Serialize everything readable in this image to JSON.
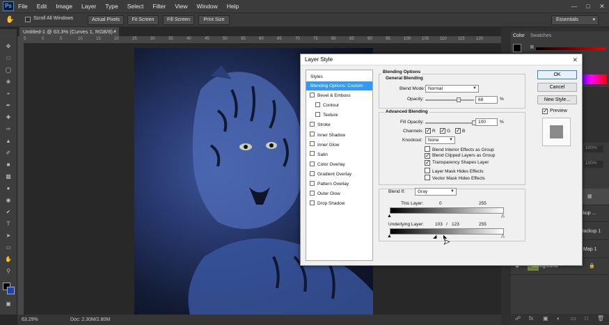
{
  "app": {
    "logo": "Ps"
  },
  "menu": [
    "File",
    "Edit",
    "Image",
    "Layer",
    "Type",
    "Select",
    "Filter",
    "View",
    "Window",
    "Help"
  ],
  "options_bar": {
    "scroll_all_windows": "Scroll All Windows",
    "buttons": [
      "Actual Pixels",
      "Fit Screen",
      "Fill Screen",
      "Print Size"
    ],
    "workspace": "Essentials"
  },
  "document": {
    "tab": "Untitled-1 @ 63.3% (Curves 1, RGB/8) *"
  },
  "ruler_marks": [
    "5",
    "0",
    "5",
    "10",
    "15",
    "20",
    "25",
    "30",
    "35",
    "40",
    "45",
    "50",
    "55",
    "60",
    "65",
    "70",
    "75",
    "80",
    "85",
    "90",
    "95",
    "100",
    "105",
    "110",
    "115",
    "120"
  ],
  "status": {
    "zoom": "63.29%",
    "doc": "Doc: 2.30M/2.80M"
  },
  "color_panel": {
    "tabs": [
      "Color",
      "Swatches"
    ],
    "channel": "R"
  },
  "layers": {
    "opacity": "100%",
    "fill": "100%",
    "rows": [
      "ackup ...",
      "Backup 1",
      "Map 1",
      "Background"
    ]
  },
  "dialog": {
    "title": "Layer Style",
    "styles_header": "Styles",
    "styles": [
      {
        "label": "Blending Options: Custom",
        "selected": true
      },
      {
        "label": "Bevel & Emboss"
      },
      {
        "label": "Contour",
        "indent": true
      },
      {
        "label": "Texture",
        "indent": true
      },
      {
        "label": "Stroke"
      },
      {
        "label": "Inner Shadow"
      },
      {
        "label": "Inner Glow"
      },
      {
        "label": "Satin"
      },
      {
        "label": "Color Overlay"
      },
      {
        "label": "Gradient Overlay"
      },
      {
        "label": "Pattern Overlay"
      },
      {
        "label": "Outer Glow"
      },
      {
        "label": "Drop Shadow"
      }
    ],
    "blending": {
      "section": "Blending Options",
      "general": "General Blending",
      "blend_mode_label": "Blend Mode:",
      "blend_mode": "Normal",
      "opacity_label": "Opacity:",
      "opacity_value": "68",
      "opacity_level": 68,
      "percent": "%"
    },
    "advanced": {
      "section": "Advanced Blending",
      "fill_label": "Fill Opacity:",
      "fill_value": "100",
      "fill_level": 100,
      "channels_label": "Channels:",
      "channels": [
        "R",
        "G",
        "B"
      ],
      "knockout_label": "Knockout:",
      "knockout": "None",
      "options": [
        {
          "label": "Blend Interior Effects as Group",
          "checked": false
        },
        {
          "label": "Blend Clipped Layers as Group",
          "checked": true
        },
        {
          "label": "Transparency Shapes Layer",
          "checked": true
        },
        {
          "label": "Layer Mask Hides Effects",
          "checked": false
        },
        {
          "label": "Vector Mask Hides Effects",
          "checked": false
        }
      ]
    },
    "blend_if": {
      "label": "Blend If:",
      "value": "Gray",
      "this_layer": "This Layer:",
      "this_low": "0",
      "this_high": "255",
      "underlying": "Underlying Layer:",
      "under_low": "103",
      "under_sep": "/",
      "under_mid": "123",
      "under_high": "255"
    },
    "buttons": {
      "ok": "OK",
      "cancel": "Cancel",
      "new_style": "New Style...",
      "preview": "Preview"
    }
  }
}
